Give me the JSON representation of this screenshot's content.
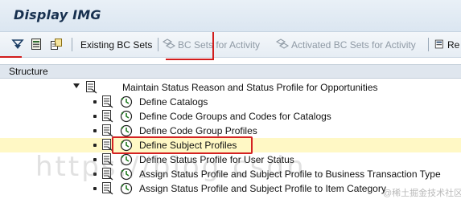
{
  "window": {
    "title": "Display IMG"
  },
  "toolbar": {
    "icons": [
      "expand-tree-icon",
      "document-icon",
      "where-used-icon"
    ],
    "buttons": [
      {
        "label": "Existing BC Sets",
        "enabled": true
      },
      {
        "label": "BC Sets for Activity",
        "enabled": false
      },
      {
        "label": "Activated BC Sets for Activity",
        "enabled": false
      },
      {
        "label": "Re",
        "enabled": true
      }
    ]
  },
  "structure": {
    "header": "Structure",
    "root": {
      "label": "Maintain Status Reason and Status Profile for Opportunities"
    },
    "items": [
      {
        "label": "Define Catalogs",
        "highlighted": false
      },
      {
        "label": "Define Code Groups and Codes for Catalogs",
        "highlighted": false
      },
      {
        "label": "Define Code Group Profiles",
        "highlighted": false
      },
      {
        "label": "Define Subject Profiles",
        "highlighted": true
      },
      {
        "label": "Define Status Profile for User Status",
        "highlighted": false
      },
      {
        "label": "Assign Status Profile and Subject Profile to Business Transaction Type",
        "highlighted": false
      },
      {
        "label": "Assign Status Profile and Subject Profile to Item Category",
        "highlighted": false
      }
    ]
  },
  "watermark": {
    "text": "https://blog.csdn...",
    "site": "@稀土掘金技术社区"
  },
  "colors": {
    "highlight": "#fff8c5",
    "annotation": "#d42222",
    "title": "#17304f"
  }
}
